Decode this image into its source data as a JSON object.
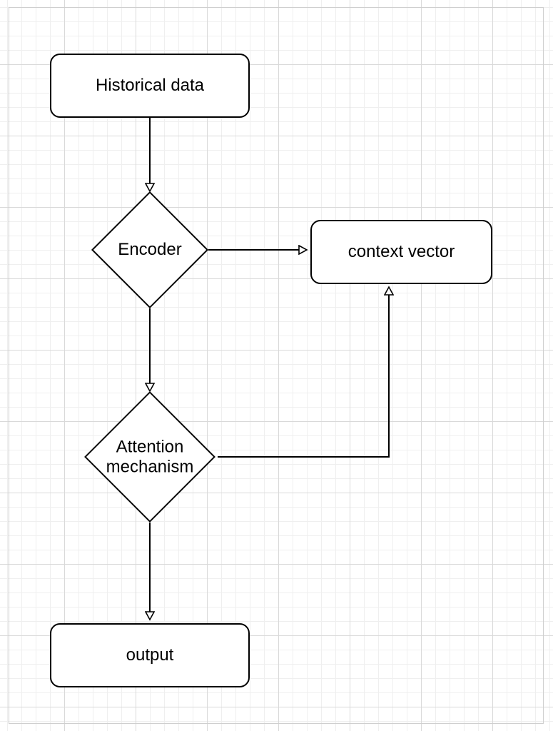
{
  "diagram": {
    "nodes": {
      "historical_data": {
        "label": "Historical data",
        "kind": "process"
      },
      "encoder": {
        "label": "Encoder",
        "kind": "decision"
      },
      "attention": {
        "label": "Attention\nmechanism",
        "kind": "decision"
      },
      "context_vector": {
        "label": "context vector",
        "kind": "process"
      },
      "output": {
        "label": "output",
        "kind": "process"
      }
    },
    "edges": [
      {
        "from": "historical_data",
        "to": "encoder"
      },
      {
        "from": "encoder",
        "to": "attention"
      },
      {
        "from": "encoder",
        "to": "context_vector"
      },
      {
        "from": "attention",
        "to": "context_vector"
      },
      {
        "from": "attention",
        "to": "output"
      }
    ]
  }
}
